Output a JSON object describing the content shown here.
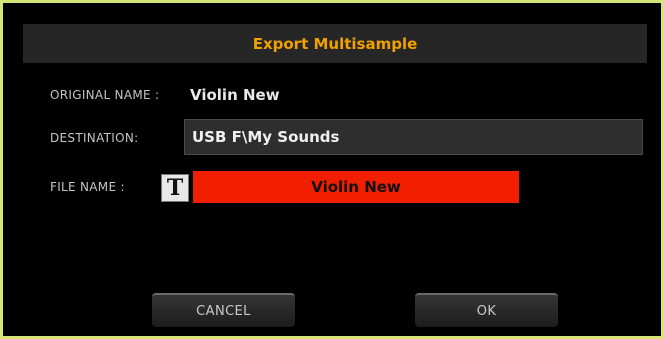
{
  "dialog": {
    "title": "Export Multisample",
    "original_name_label": "ORIGINAL NAME :",
    "original_name_value": "Violin New",
    "destination_label": "DESTINATION:",
    "destination_value": "USB F\\My Sounds",
    "file_name_label": "FILE NAME :",
    "text_edit_icon": "T",
    "file_name_value": "Violin New",
    "cancel_label": "CANCEL",
    "ok_label": "OK"
  },
  "colors": {
    "border": "#d6e47a",
    "title_text": "#f0a000",
    "file_field_bg": "#f21e00"
  },
  "icons": {
    "text_edit": "text-edit-icon"
  }
}
